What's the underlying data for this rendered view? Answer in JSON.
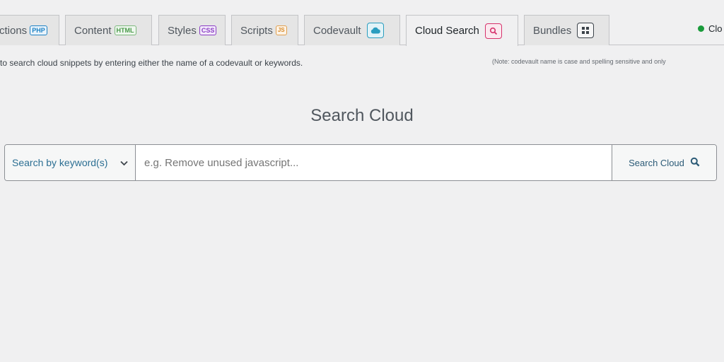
{
  "tabs": [
    {
      "label": "ctions",
      "badge": "PHP"
    },
    {
      "label": "Content",
      "badge": "HTML"
    },
    {
      "label": "Styles",
      "badge": "CSS"
    },
    {
      "label": "Scripts",
      "badge": "JS"
    },
    {
      "label": "Codevault",
      "icon": "cloud-icon"
    },
    {
      "label": "Cloud Search",
      "icon": "search-icon",
      "active": true
    },
    {
      "label": "Bundles",
      "icon": "grid-icon"
    }
  ],
  "status": {
    "label": "Clo",
    "color": "#1a9b3b"
  },
  "description": "to search cloud snippets by entering either the name of a codevault or keywords.",
  "note": "(Note: codevault name is case and spelling sensitive and only",
  "title": "Search Cloud",
  "search": {
    "mode": "Search by keyword(s)",
    "placeholder": "e.g. Remove unused javascript...",
    "button_label": "Search Cloud"
  },
  "colors": {
    "accent": "#d6336c",
    "link": "#2c6f93"
  }
}
